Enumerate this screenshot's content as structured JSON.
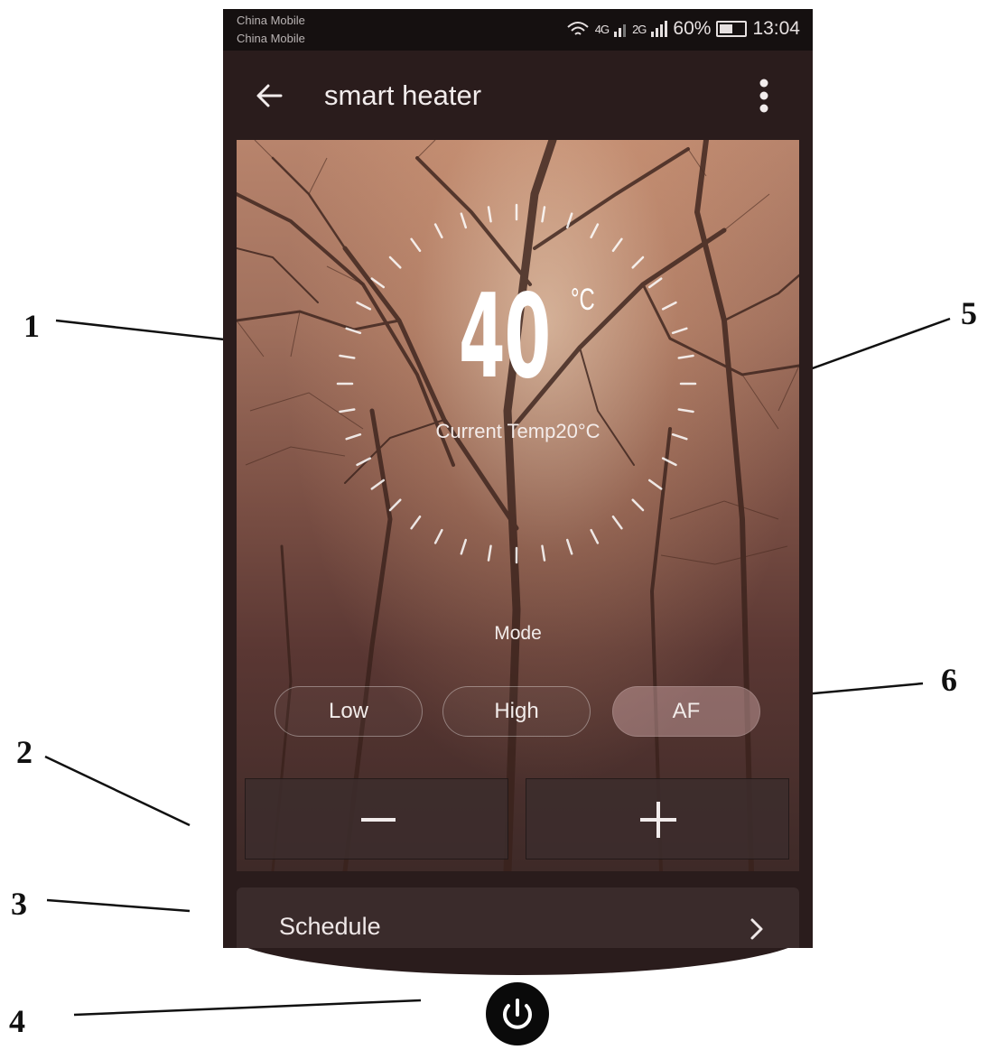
{
  "status_bar": {
    "carrier_1": "China Mobile",
    "carrier_2": "China Mobile",
    "signal_1": "4G",
    "signal_2": "2G",
    "battery": "60%",
    "time": "13:04"
  },
  "app_bar": {
    "title": "smart heater",
    "back_icon": "arrow-left-icon",
    "more_icon": "more-vertical-icon"
  },
  "thermostat": {
    "set_temp": "40",
    "unit": "°C",
    "current_temp_label": "Current Temp20°C"
  },
  "mode": {
    "label": "Mode",
    "options": [
      "Low",
      "High",
      "AF"
    ],
    "selected": "AF"
  },
  "adjust": {
    "decrease_icon": "minus-icon",
    "increase_icon": "plus-icon"
  },
  "schedule": {
    "label": "Schedule",
    "icon": "chevron-right-icon"
  },
  "power": {
    "icon": "power-icon"
  },
  "callouts": [
    "1",
    "2",
    "3",
    "4",
    "5",
    "6"
  ],
  "colors": {
    "app_background": "#2a1c1c",
    "status_bar": "#151010",
    "selected_mode": "#b98f8f",
    "power_button": "#0a0a0a"
  }
}
